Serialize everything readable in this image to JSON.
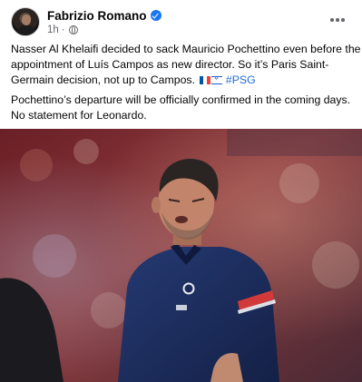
{
  "post": {
    "author": "Fabrizio Romano",
    "time": "1h",
    "separator": "·",
    "audience_icon": "globe-icon",
    "more_icon": "more-horizontal-icon",
    "paragraph1_lines": [
      "Nasser Al Khelaifi decided to sack Mauricio Pochettino even before the",
      "appointment of Luís Campos as new director. So it’s Paris Saint-",
      "Germain decision, not up to Campos."
    ],
    "flags": [
      "flag-france-icon",
      "flag-israel-icon"
    ],
    "hashtag": "#PSG",
    "paragraph2_lines": [
      "Pochettino’s departure will be officially confirmed in the coming days.",
      "No statement for Leonardo."
    ]
  },
  "colors": {
    "verified_blue": "#1877f2",
    "link_blue": "#216fdb",
    "meta_gray": "#65676b",
    "psg_navy": "#1d2b5c",
    "psg_red": "#d23a3a"
  }
}
